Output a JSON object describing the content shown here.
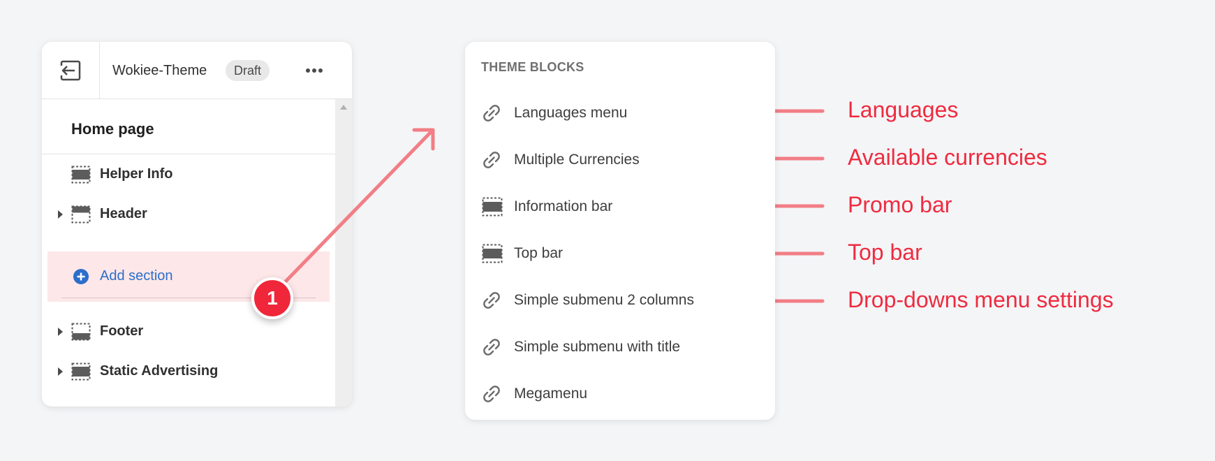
{
  "editor": {
    "theme_name": "Wokiee-Theme",
    "status_badge": "Draft",
    "page_title": "Home page",
    "sections": [
      {
        "label": "Helper Info",
        "expandable": false
      },
      {
        "label": "Header",
        "expandable": true
      },
      {
        "label": "Footer",
        "expandable": true
      },
      {
        "label": "Static Advertising",
        "expandable": true
      }
    ],
    "add_section_label": "Add section",
    "step_number": "1",
    "icons": {
      "exit": "exit-icon",
      "more": "more-horizontal-icon",
      "section": "section-icon",
      "add": "plus-circle-icon"
    }
  },
  "theme_blocks": {
    "heading": "THEME BLOCKS",
    "items": [
      {
        "label": "Languages menu",
        "icon": "link-icon"
      },
      {
        "label": "Multiple Currencies",
        "icon": "link-icon"
      },
      {
        "label": "Information bar",
        "icon": "section-icon"
      },
      {
        "label": "Top bar",
        "icon": "section-icon"
      },
      {
        "label": "Simple submenu 2 columns",
        "icon": "link-icon"
      },
      {
        "label": "Simple submenu with title",
        "icon": "link-icon"
      },
      {
        "label": "Megamenu",
        "icon": "link-icon"
      }
    ]
  },
  "annotations": [
    {
      "label": "Languages"
    },
    {
      "label": "Available currencies"
    },
    {
      "label": "Promo bar"
    },
    {
      "label": "Top bar"
    },
    {
      "label": "Drop-downs menu settings"
    }
  ],
  "colors": {
    "accent_red": "#ef2b3f",
    "arrow_pink": "#f27e86",
    "add_highlight": "#fde7e8",
    "link_blue": "#2c6ecb",
    "page_background": "#f4f5f7"
  }
}
